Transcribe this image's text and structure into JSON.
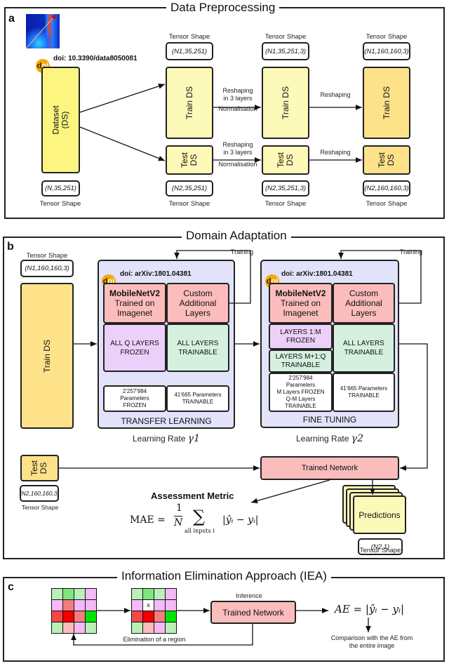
{
  "panel_a": {
    "label": "a",
    "title": "Data Preprocessing",
    "doi": "doi: 10.3390/data8050081",
    "doi_badge": "doi",
    "dataset": {
      "label_line1": "Dataset",
      "label_line2": "(DS)",
      "tensor_shape": "(N,35,251)",
      "tensor_label": "Tensor Shape"
    },
    "stage1": {
      "train_label": "Train DS",
      "train_shape": "(N1,35,251)",
      "test_label_line1": "Test",
      "test_label_line2": "DS",
      "test_shape": "(N2,35,251)",
      "tensor_label": "Tensor Shape"
    },
    "stage2": {
      "train_label": "Train DS",
      "train_shape": "(N1,35,251,3)",
      "test_label_line1": "Test",
      "test_label_line2": "DS",
      "test_shape": "(N2,35,251,3)",
      "tensor_label": "Tensor Shape"
    },
    "stage3": {
      "train_label": "Train DS",
      "train_shape": "(N1,160,160,3)",
      "test_label_line1": "Test",
      "test_label_line2": "DS",
      "test_shape": "(N2,160,160,3)",
      "tensor_label": "Tensor Shape"
    },
    "arrow1_top": "Reshaping\nin 3 layers",
    "arrow1_bottom": "Normalisation",
    "arrow2": "Reshaping",
    "heatmap_icon": "spectrogram-thumbnail"
  },
  "panel_b": {
    "label": "b",
    "title": "Domain Adaptation",
    "train_ds": {
      "label": "Train DS",
      "shape": "(N1,160,160,3)",
      "tensor_label": "Tensor Shape"
    },
    "test_ds": {
      "label_line1": "Test",
      "label_line2": "DS",
      "shape": "(N2,160,160,3)",
      "tensor_label": "Tensor Shape"
    },
    "training_label": "Training",
    "transfer": {
      "doi": "doi: arXiv:1801.04381",
      "model_title": "MobileNetV2",
      "model_sub": "Trained on\nImagenet",
      "custom": "Custom\nAdditional\nLayers",
      "frozen": "ALL Q LAYERS\nFROZEN",
      "trainable": "ALL LAYERS\nTRAINABLE",
      "params_frozen": "2'257'984\nParameters\nFROZEN",
      "params_trainable": "41'665 Parameters\nTRAINABLE",
      "footer": "TRANSFER LEARNING",
      "lr_label": "Learning Rate",
      "lr_symbol": "γ1"
    },
    "finetune": {
      "doi": "doi: arXiv:1801.04381",
      "model_title": "MobileNetV2",
      "model_sub": "Trained on\nImagenet",
      "custom": "Custom\nAdditional\nLayers",
      "frozen": "LAYERS 1:M\nFROZEN",
      "partial_trainable": "LAYERS M+1:Q\nTRAINABLE",
      "trainable": "ALL LAYERS\nTRAINABLE",
      "params_frozen": "2'257'984\nParameters\nM Layers FROZEN\nQ-M Layers\nTRAINABLE",
      "params_trainable": "41'665 Parameters\nTRAINABLE",
      "footer": "FINE TUNING",
      "lr_label": "Learning Rate",
      "lr_symbol": "γ2"
    },
    "trained_network": "Trained Network",
    "assessment_title": "Assessment Metric",
    "mae_lhs": "MAE =",
    "mae_num": "1",
    "mae_den": "N",
    "mae_sum": "∑",
    "mae_sub": "all inputs i",
    "mae_abs": "|ŷᵢ − yᵢ|",
    "predictions": {
      "label": "Predictions",
      "shape": "(N2,1)",
      "tensor_label": "Tensor Shape"
    }
  },
  "panel_c": {
    "label": "c",
    "title": "Information Elimination Approach (IEA)",
    "grid_colors": [
      [
        "#b9f0b9",
        "#7fe57f",
        "#b9f0b9",
        "#f7b8f7"
      ],
      [
        "#f7b8f7",
        "#f47c7c",
        "#f7b8f7",
        "#f7b8f7"
      ],
      [
        "#f44848",
        "#f20000",
        "#f47c7c",
        "#00e600"
      ],
      [
        "#b9f0b9",
        "#fbbcbc",
        "#f7b8f7",
        "#b9f0b9"
      ]
    ],
    "eliminated_mark": "x",
    "elimination_caption": "Elimination of a region",
    "inference_label": "Inference",
    "trained_network": "Trained Network",
    "ae_formula": "AE = |ŷᵢ − yᵢ|",
    "comparison": "Comparison with the AE from\nthe entire image"
  },
  "colors": {
    "dataset_yellow": "#fcf680",
    "pale_yellow": "#fdf9b8",
    "orange_yellow": "#fde28a",
    "lavender": "#e2e2fb",
    "pink": "#fbbcbc",
    "purple": "#ecd0fa",
    "mint": "#d6f0e0",
    "doi_orange": "#f5a800"
  }
}
